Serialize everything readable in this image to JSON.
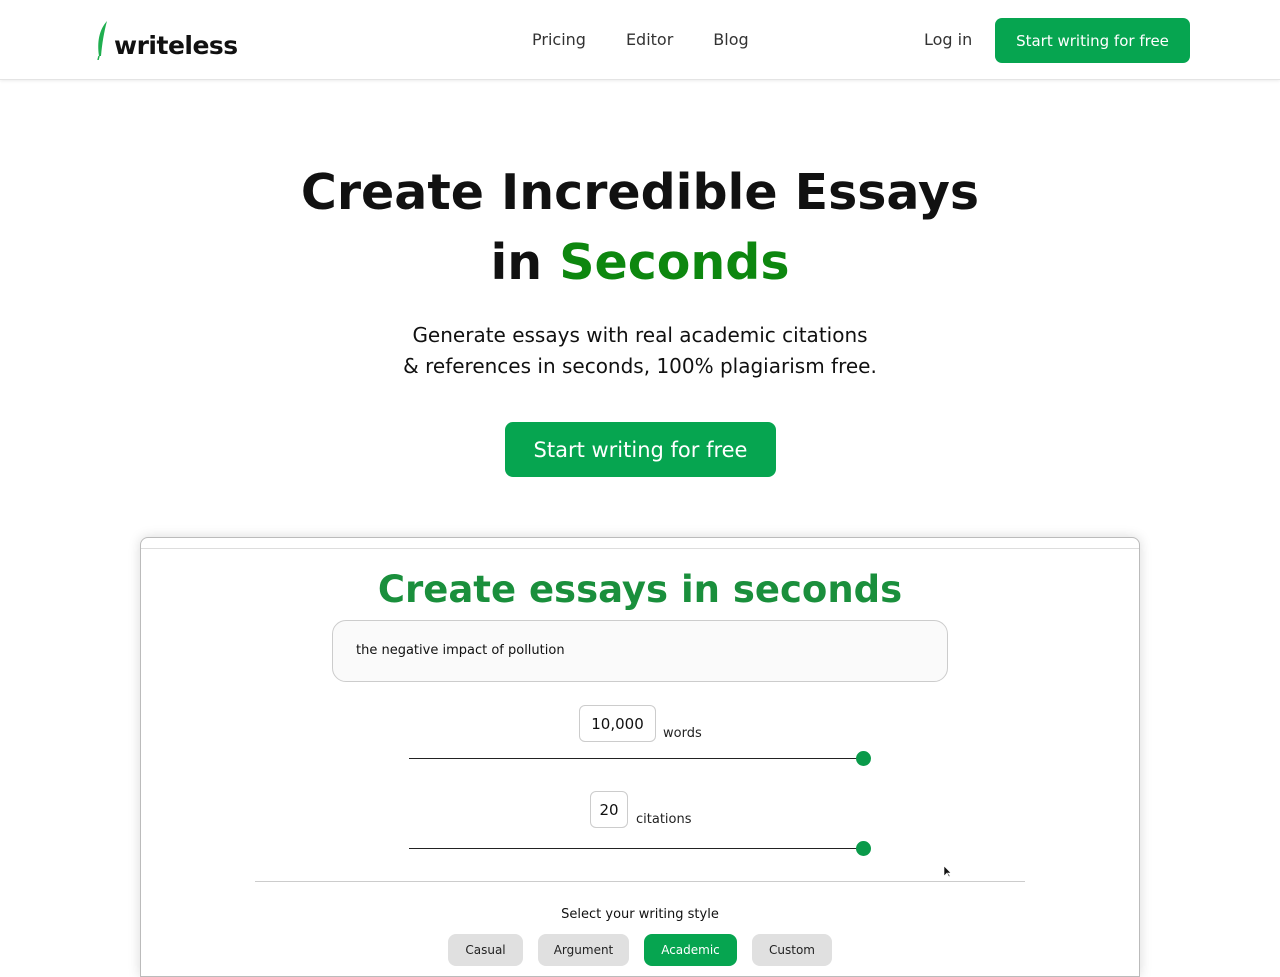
{
  "nav": {
    "logo": "writeless",
    "links": [
      "Pricing",
      "Editor",
      "Blog"
    ],
    "login": "Log in",
    "cta": "Start writing for free"
  },
  "hero": {
    "title_line1": "Create Incredible Essays",
    "title_in": "in",
    "title_highlight": "Seconds",
    "subtitle_line1": "Generate essays with real academic citations",
    "subtitle_line2": "& references in seconds, 100% plagiarism free.",
    "cta": "Start writing for free"
  },
  "demo": {
    "title": "Create essays in seconds",
    "topic": "the negative impact of pollution",
    "words": {
      "value": "10,000",
      "unit": "words",
      "slider_percent": 100
    },
    "citations": {
      "value": "20",
      "unit": "citations",
      "slider_percent": 100
    },
    "style_label": "Select your writing style",
    "styles": [
      "Casual",
      "Argument",
      "Academic",
      "Custom"
    ],
    "selected_style": "Academic"
  },
  "colors": {
    "brand": "#06a550",
    "highlight": "#0d870f"
  }
}
